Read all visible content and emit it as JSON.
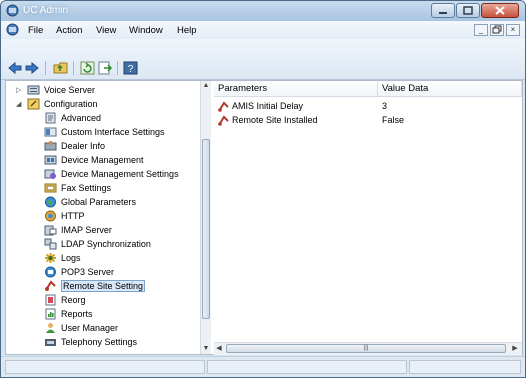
{
  "window": {
    "title": "UC Admin"
  },
  "menu": {
    "items": [
      "File",
      "Action",
      "View",
      "Window",
      "Help"
    ]
  },
  "tree": {
    "items": [
      {
        "label": "Voice Server",
        "icon": "server-icon"
      },
      {
        "label": "Configuration",
        "icon": "configuration-icon"
      },
      {
        "label": "Advanced",
        "icon": "advanced-icon"
      },
      {
        "label": "Custom Interface Settings",
        "icon": "custom-interface-icon"
      },
      {
        "label": "Dealer Info",
        "icon": "dealer-info-icon"
      },
      {
        "label": "Device Management",
        "icon": "device-management-icon"
      },
      {
        "label": "Device Management Settings",
        "icon": "device-settings-icon"
      },
      {
        "label": "Fax Settings",
        "icon": "fax-icon"
      },
      {
        "label": "Global Parameters",
        "icon": "globe-icon"
      },
      {
        "label": "HTTP",
        "icon": "http-icon"
      },
      {
        "label": "IMAP Server",
        "icon": "imap-server-icon"
      },
      {
        "label": "LDAP Synchronization",
        "icon": "ldap-icon"
      },
      {
        "label": "Logs",
        "icon": "logs-icon"
      },
      {
        "label": "POP3 Server",
        "icon": "pop3-icon"
      },
      {
        "label": "Remote Site Setting",
        "icon": "remote-site-icon"
      },
      {
        "label": "Reorg",
        "icon": "reorg-icon"
      },
      {
        "label": "Reports",
        "icon": "reports-icon"
      },
      {
        "label": "User Manager",
        "icon": "user-manager-icon"
      },
      {
        "label": "Telephony Settings",
        "icon": "telephony-icon"
      }
    ],
    "selected": "Remote Site Setting"
  },
  "list": {
    "columns": [
      "Parameters",
      "Value Data"
    ],
    "rows": [
      {
        "parameter": "AMIS Initial Delay",
        "value": "3"
      },
      {
        "parameter": "Remote Site Installed",
        "value": "False"
      }
    ]
  },
  "colors": {
    "accent": "#3f6ea5",
    "selection": "#d9e9fb",
    "title_bar": "#b7cfe7"
  }
}
